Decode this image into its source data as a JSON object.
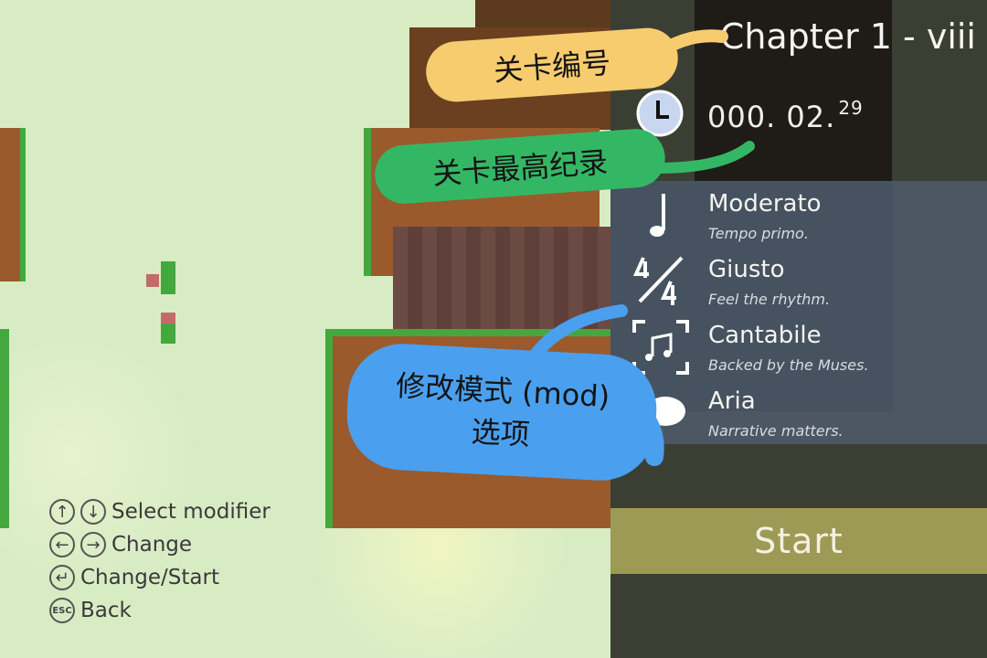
{
  "level": {
    "chapter_title": "Chapter 1 - viii",
    "best_time_main": "000. 02.",
    "best_time_frac": "29"
  },
  "modifiers": [
    {
      "name": "Moderato",
      "desc": "Tempo primo.",
      "icon": "quarter-note-icon"
    },
    {
      "name": "Giusto",
      "desc": "Feel the rhythm.",
      "icon": "time-signature-icon"
    },
    {
      "name": "Cantabile",
      "desc": "Backed by the Muses.",
      "icon": "music-frame-icon"
    },
    {
      "name": "Aria",
      "desc": "Narrative matters.",
      "icon": "speech-bubble-icon"
    }
  ],
  "start_label": "Start",
  "help": {
    "select": "Select modifier",
    "change": "Change",
    "change_start": "Change/Start",
    "back": "Back",
    "esc_key": "ESC"
  },
  "annotations": {
    "level_number": "关卡编号",
    "best_record": "关卡最高纪录",
    "mod_options_line1": "修改模式 (mod)",
    "mod_options_line2": "选项"
  },
  "colors": {
    "background": "#d8ecc4",
    "dirt": "#9a5a2c",
    "grass": "#45a83e",
    "panel": "#3b3f33",
    "mod_panel": "#4d5966",
    "start_bar": "#9c9a55",
    "annotation_yellow": "#f7cc6f",
    "annotation_green": "#34b765",
    "annotation_blue": "#4aa0ef"
  }
}
